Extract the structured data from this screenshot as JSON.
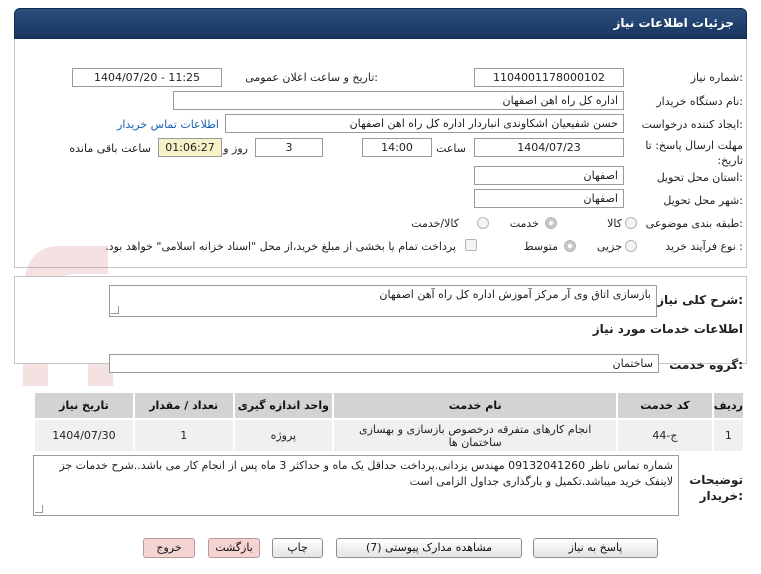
{
  "header": {
    "title": "جزئیات اطلاعات نیاز"
  },
  "form": {
    "need_number": {
      "label": "شماره نیاز:",
      "value": "1104001178000102"
    },
    "announce": {
      "label": "تاریخ و ساعت اعلان عمومی:",
      "value": "1404/07/20 - 11:25"
    },
    "buyer_org": {
      "label": "نام دستگاه خریدار:",
      "value": "اداره کل راه اهن اصفهان"
    },
    "creator": {
      "label": "ایجاد کننده درخواست:",
      "value": "حسن شفیعیان اشکاوندی انباردار اداره کل راه اهن اصفهان",
      "contact_link": "اطلاعات تماس خریدار"
    },
    "deadline": {
      "label": "مهلت ارسال پاسخ: تا تاریخ:",
      "date": "1404/07/23",
      "time_label": "ساعت",
      "time": "14:00",
      "days": "3",
      "days_label": "روز و",
      "remaining": "01:06:27",
      "remaining_label": "ساعت باقی مانده"
    },
    "province": {
      "label": "استان محل تحویل:",
      "value": "اصفهان"
    },
    "city": {
      "label": "شهر محل تحویل:",
      "value": "اصفهان"
    },
    "category": {
      "label": "طبقه بندی موضوعی:",
      "options": [
        "کالا",
        "خدمت",
        "کالا/خدمت"
      ],
      "selected": "خدمت"
    },
    "process": {
      "label": "نوع فرآیند خرید :",
      "options": [
        "جزیی",
        "متوسط"
      ],
      "selected": "متوسط",
      "payment_note": "پرداخت تمام یا بخشی از مبلغ خرید،از محل \"اسناد خزانه اسلامی\" خواهد بود."
    }
  },
  "summary": {
    "label": "شرح کلی نیاز:",
    "value": "بازسازی اتاق وی آر مرکز آموزش اداره کل راه آهن اصفهان"
  },
  "services_section": {
    "title": "اطلاعات خدمات مورد نیاز",
    "group_label": "گروه خدمت:",
    "group_value": "ساختمان"
  },
  "table": {
    "headers": [
      "ردیف",
      "کد خدمت",
      "نام خدمت",
      "واحد اندازه گیری",
      "تعداد / مقدار",
      "تاریخ نیاز"
    ],
    "rows": [
      [
        "1",
        "ج-44",
        "انجام کارهای متفرقه درخصوص بازسازی و بهسازی ساختمان ها",
        "پروژه",
        "1",
        "1404/07/30"
      ]
    ]
  },
  "notes": {
    "label": "توضیحات خریدار:",
    "value": "شماره تماس ناظر 09132041260 مهندس یزدانی.پرداخت حداقل یک ماه و حداکثر 3 ماه پس از انجام کار می باشد..شرح خدمات جز لاینفک خرید میباشد.تکمیل و بارگذاری جداول الزامی است"
  },
  "buttons": {
    "reply": "پاسخ به نیاز",
    "docs": "مشاهده مدارک پیوستی (7)",
    "print": "چاپ",
    "back": "بازگشت",
    "exit": "خروج"
  },
  "watermark": {
    "text": "AriaTender.net",
    "color": "#b21f24"
  }
}
